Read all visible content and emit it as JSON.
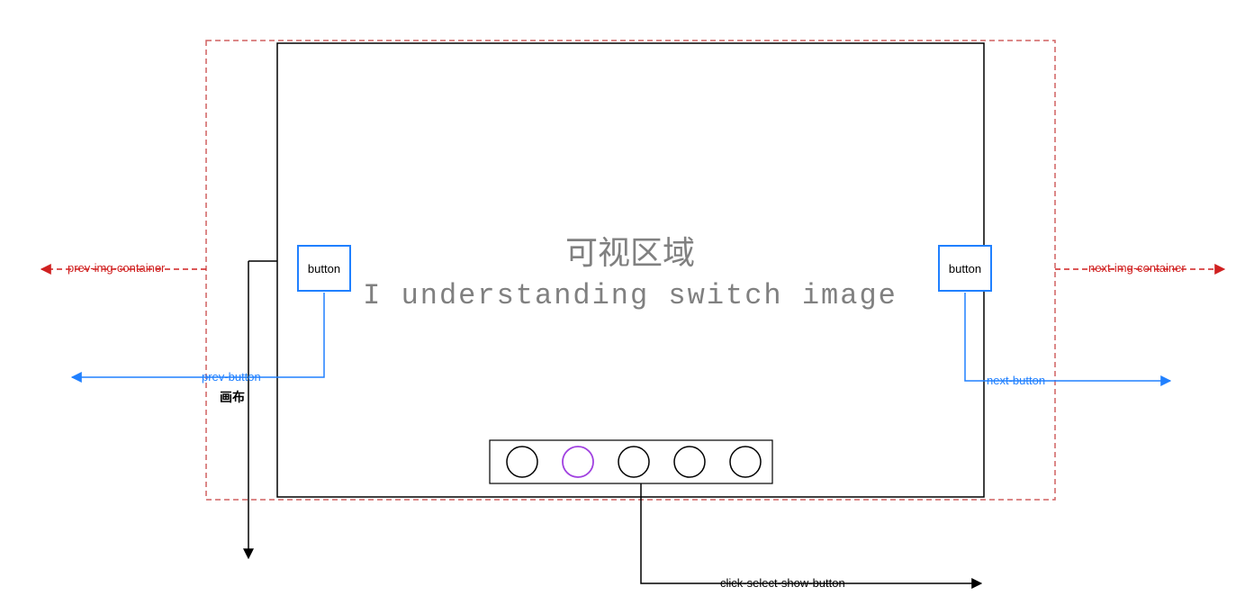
{
  "center": {
    "title": "可视区域",
    "subtitle": "I understanding switch image"
  },
  "buttons": {
    "prev_label": "button",
    "next_label": "button"
  },
  "labels": {
    "prev_button": "prev-button",
    "next_button": "next-button",
    "prev_container": "prev-img-container",
    "next_container": "next-img-container",
    "click_select": "click-select-show-button",
    "canvas": "画布"
  },
  "indicators": {
    "count": 5,
    "active_index": 1
  },
  "colors": {
    "blue": "#2080ff",
    "red": "#d02020",
    "black": "#000000",
    "purple": "#a040e0",
    "grey": "#808080",
    "dashed_red": "#d06060"
  }
}
